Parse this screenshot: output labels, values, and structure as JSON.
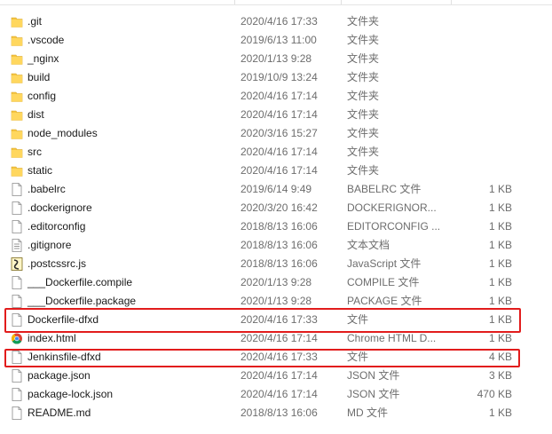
{
  "files": [
    {
      "name": ".git",
      "date": "2020/4/16 17:33",
      "type": "文件夹",
      "size": "",
      "icon": "folder-icon"
    },
    {
      "name": ".vscode",
      "date": "2019/6/13 11:00",
      "type": "文件夹",
      "size": "",
      "icon": "folder-icon"
    },
    {
      "name": "_nginx",
      "date": "2020/1/13 9:28",
      "type": "文件夹",
      "size": "",
      "icon": "folder-icon"
    },
    {
      "name": "build",
      "date": "2019/10/9 13:24",
      "type": "文件夹",
      "size": "",
      "icon": "folder-icon"
    },
    {
      "name": "config",
      "date": "2020/4/16 17:14",
      "type": "文件夹",
      "size": "",
      "icon": "folder-icon"
    },
    {
      "name": "dist",
      "date": "2020/4/16 17:14",
      "type": "文件夹",
      "size": "",
      "icon": "folder-icon"
    },
    {
      "name": "node_modules",
      "date": "2020/3/16 15:27",
      "type": "文件夹",
      "size": "",
      "icon": "folder-icon"
    },
    {
      "name": "src",
      "date": "2020/4/16 17:14",
      "type": "文件夹",
      "size": "",
      "icon": "folder-icon"
    },
    {
      "name": "static",
      "date": "2020/4/16 17:14",
      "type": "文件夹",
      "size": "",
      "icon": "folder-icon"
    },
    {
      "name": ".babelrc",
      "date": "2019/6/14 9:49",
      "type": "BABELRC 文件",
      "size": "1 KB",
      "icon": "file-icon"
    },
    {
      "name": ".dockerignore",
      "date": "2020/3/20 16:42",
      "type": "DOCKERIGNOR...",
      "size": "1 KB",
      "icon": "file-icon"
    },
    {
      "name": ".editorconfig",
      "date": "2018/8/13 16:06",
      "type": "EDITORCONFIG ...",
      "size": "1 KB",
      "icon": "file-icon"
    },
    {
      "name": ".gitignore",
      "date": "2018/8/13 16:06",
      "type": "文本文档",
      "size": "1 KB",
      "icon": "text-file-icon"
    },
    {
      "name": ".postcssrc.js",
      "date": "2018/8/13 16:06",
      "type": "JavaScript 文件",
      "size": "1 KB",
      "icon": "javascript-file-icon"
    },
    {
      "name": "___Dockerfile.compile",
      "date": "2020/1/13 9:28",
      "type": "COMPILE 文件",
      "size": "1 KB",
      "icon": "file-icon"
    },
    {
      "name": "___Dockerfile.package",
      "date": "2020/1/13 9:28",
      "type": "PACKAGE 文件",
      "size": "1 KB",
      "icon": "file-icon"
    },
    {
      "name": "Dockerfile-dfxd",
      "date": "2020/4/16 17:33",
      "type": "文件",
      "size": "1 KB",
      "icon": "file-icon"
    },
    {
      "name": "index.html",
      "date": "2020/4/16 17:14",
      "type": "Chrome HTML D...",
      "size": "1 KB",
      "icon": "chrome-icon"
    },
    {
      "name": "Jenkinsfile-dfxd",
      "date": "2020/4/16 17:33",
      "type": "文件",
      "size": "4 KB",
      "icon": "file-icon"
    },
    {
      "name": "package.json",
      "date": "2020/4/16 17:14",
      "type": "JSON 文件",
      "size": "3 KB",
      "icon": "file-icon"
    },
    {
      "name": "package-lock.json",
      "date": "2020/4/16 17:14",
      "type": "JSON 文件",
      "size": "470 KB",
      "icon": "file-icon"
    },
    {
      "name": "README.md",
      "date": "2018/8/13 16:06",
      "type": "MD 文件",
      "size": "1 KB",
      "icon": "file-icon"
    }
  ],
  "colors": {
    "highlight": "#e21c1c",
    "folder": "#f5c542",
    "metadata_text": "#6d6d6d"
  }
}
